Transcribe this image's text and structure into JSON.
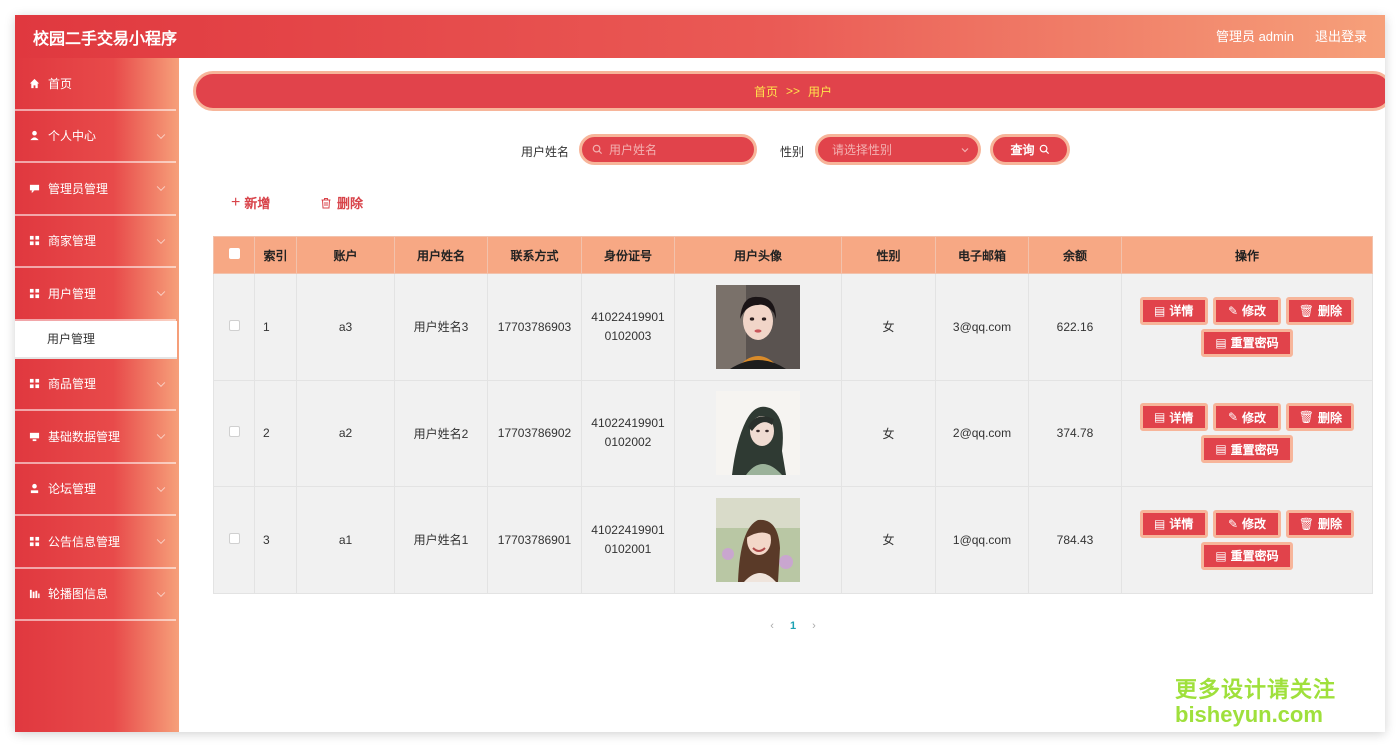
{
  "app": {
    "title": "校园二手交易小程序",
    "admin": "管理员 admin",
    "logout": "退出登录"
  },
  "sidebar": {
    "items": [
      {
        "label": "首页",
        "icon": "home-icon"
      },
      {
        "label": "个人中心",
        "icon": "user-icon"
      },
      {
        "label": "管理员管理",
        "icon": "chat-icon"
      },
      {
        "label": "商家管理",
        "icon": "grid-icon"
      },
      {
        "label": "用户管理",
        "icon": "grid-icon"
      },
      {
        "label": "商品管理",
        "icon": "grid-icon"
      },
      {
        "label": "基础数据管理",
        "icon": "monitor-icon"
      },
      {
        "label": "论坛管理",
        "icon": "person-icon"
      },
      {
        "label": "公告信息管理",
        "icon": "grid-icon"
      },
      {
        "label": "轮播图信息",
        "icon": "bars-icon"
      }
    ],
    "sub_active": "用户管理"
  },
  "breadcrumb": {
    "home": "首页",
    "sep": ">>",
    "current": "用户"
  },
  "search": {
    "name_label": "用户姓名",
    "name_placeholder": "用户姓名",
    "gender_label": "性别",
    "gender_placeholder": "请选择性别",
    "query_label": "查询"
  },
  "actions": {
    "add": "新增",
    "delete": "删除"
  },
  "table": {
    "headers": [
      "索引",
      "账户",
      "用户姓名",
      "联系方式",
      "身份证号",
      "用户头像",
      "性别",
      "电子邮箱",
      "余额",
      "操作"
    ],
    "rows": [
      {
        "index": "1",
        "account": "a3",
        "name": "用户姓名3",
        "phone": "17703786903",
        "id1": "41022419901",
        "id2": "0102003",
        "gender": "女",
        "email": "3@qq.com",
        "balance": "622.16"
      },
      {
        "index": "2",
        "account": "a2",
        "name": "用户姓名2",
        "phone": "17703786902",
        "id1": "41022419901",
        "id2": "0102002",
        "gender": "女",
        "email": "2@qq.com",
        "balance": "374.78"
      },
      {
        "index": "3",
        "account": "a1",
        "name": "用户姓名1",
        "phone": "17703786901",
        "id1": "41022419901",
        "id2": "0102001",
        "gender": "女",
        "email": "1@qq.com",
        "balance": "784.43"
      }
    ],
    "ops": {
      "detail": "详情",
      "edit": "修改",
      "delete": "删除",
      "reset": "重置密码"
    }
  },
  "pager": {
    "prev": "‹",
    "current": "1",
    "next": "›"
  },
  "watermark": {
    "line1": "更多设计请关注",
    "line2": "bisheyun.com"
  },
  "colors": {
    "primary": "#e1434b",
    "accent_border": "#f7b59a",
    "header_bg": "#f7a884",
    "crumb_text": "#ffe34d"
  }
}
